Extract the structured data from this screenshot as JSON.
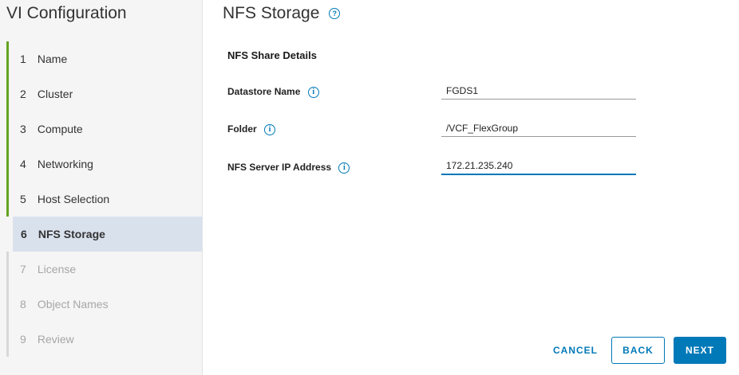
{
  "wizard": {
    "title": "VI Configuration",
    "steps": [
      {
        "num": "1",
        "label": "Name"
      },
      {
        "num": "2",
        "label": "Cluster"
      },
      {
        "num": "3",
        "label": "Compute"
      },
      {
        "num": "4",
        "label": "Networking"
      },
      {
        "num": "5",
        "label": "Host Selection"
      },
      {
        "num": "6",
        "label": "NFS Storage"
      },
      {
        "num": "7",
        "label": "License"
      },
      {
        "num": "8",
        "label": "Object Names"
      },
      {
        "num": "9",
        "label": "Review"
      }
    ]
  },
  "page": {
    "title": "NFS Storage",
    "help_icon": "?",
    "section_title": "NFS Share Details",
    "fields": [
      {
        "label": "Datastore Name",
        "value": "FGDS1"
      },
      {
        "label": "Folder",
        "value": "/VCF_FlexGroup"
      },
      {
        "label": "NFS Server IP Address",
        "value": "172.21.235.240"
      }
    ],
    "info_icon": "i"
  },
  "footer": {
    "cancel_label": "CANCEL",
    "back_label": "BACK",
    "next_label": "NEXT"
  },
  "colors": {
    "accent": "#0079b8",
    "completed_rail": "#62a420",
    "active_step_bg": "#d9e1ed"
  }
}
